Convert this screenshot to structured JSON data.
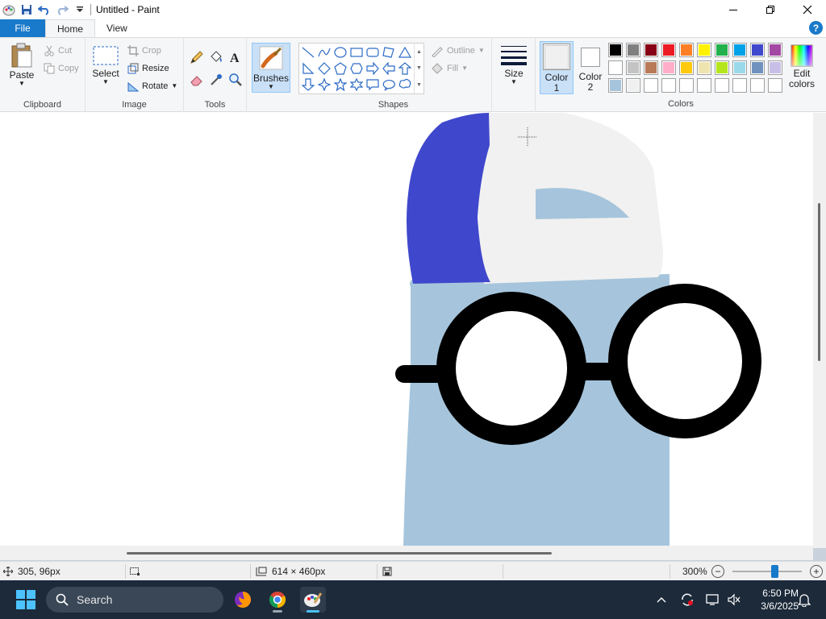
{
  "window": {
    "title": "Untitled - Paint"
  },
  "tabs": {
    "file": "File",
    "home": "Home",
    "view": "View"
  },
  "ribbon": {
    "clipboard": {
      "label": "Clipboard",
      "paste": "Paste",
      "cut": "Cut",
      "copy": "Copy"
    },
    "image": {
      "label": "Image",
      "select": "Select",
      "crop": "Crop",
      "resize": "Resize",
      "rotate": "Rotate"
    },
    "tools": {
      "label": "Tools"
    },
    "brushes": "Brushes",
    "shapes": {
      "label": "Shapes",
      "outline": "Outline",
      "fill": "Fill"
    },
    "size": "Size",
    "color1": {
      "line1": "Color",
      "line2": "1"
    },
    "color2": {
      "line1": "Color",
      "line2": "2"
    },
    "colors": {
      "label": "Colors",
      "edit_line1": "Edit",
      "edit_line2": "colors",
      "palette_row1": [
        "#000000",
        "#7f7f7f",
        "#880015",
        "#ed1c24",
        "#ff7f27",
        "#fff200",
        "#22b14c",
        "#00a2e8",
        "#3f48cc",
        "#a349a4"
      ],
      "palette_row2": [
        "#ffffff",
        "#c3c3c3",
        "#b97a57",
        "#ffaec9",
        "#ffc90e",
        "#efe4b0",
        "#b5e61d",
        "#99d9ea",
        "#7092be",
        "#c8bfe7"
      ],
      "palette_row3": [
        "#a6c5dc",
        "#f0f0f0",
        "#ffffff",
        "#ffffff",
        "#ffffff",
        "#ffffff",
        "#ffffff",
        "#ffffff",
        "#ffffff",
        "#ffffff"
      ]
    }
  },
  "status": {
    "cursor": "305, 96px",
    "canvas_size": "614 × 460px",
    "zoom": "300%"
  },
  "taskbar": {
    "search": "Search",
    "time": "6:50 PM",
    "date": "3/6/2025"
  },
  "drawing_colors": {
    "hat_blue": "#3f48cc",
    "hat_white": "#f1f1f1",
    "body_blue": "#a6c5dc",
    "glasses": "#000000"
  }
}
